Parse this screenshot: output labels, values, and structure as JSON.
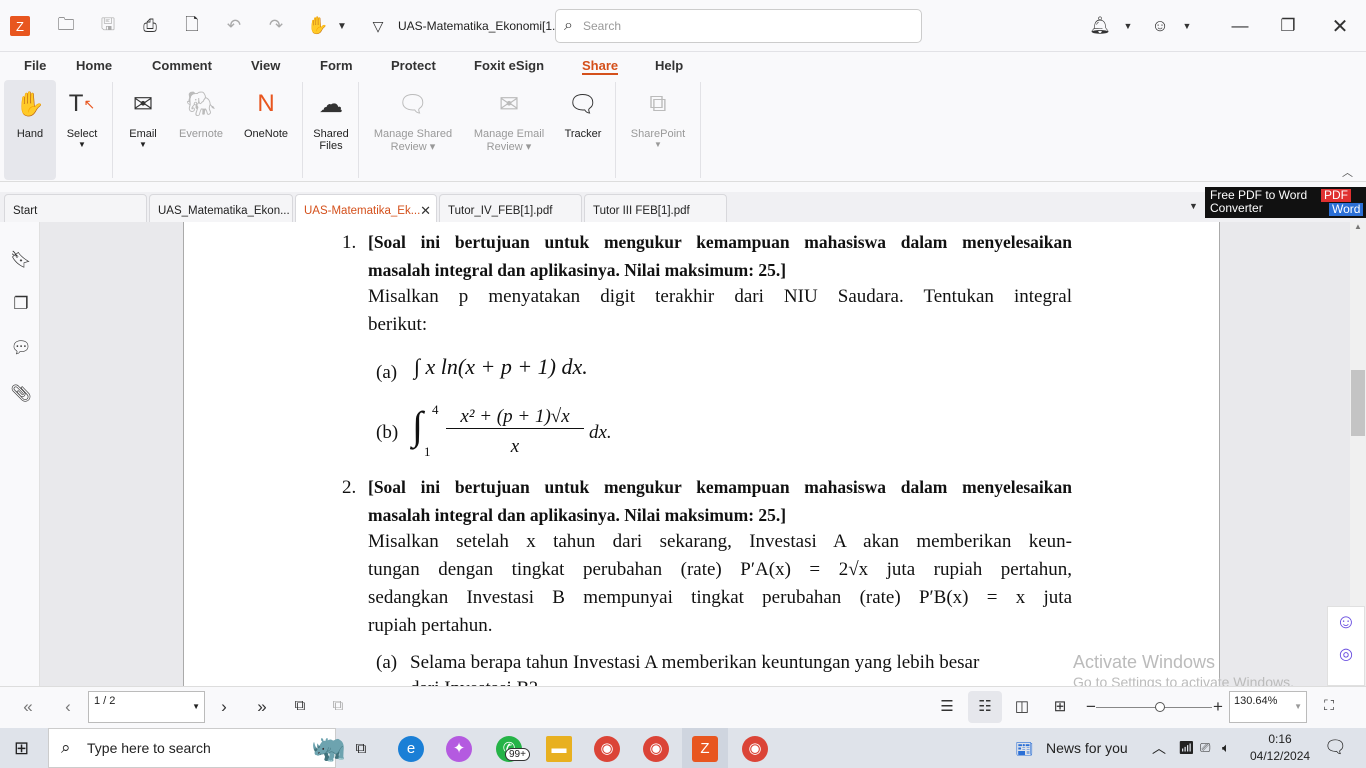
{
  "titlebar": {
    "doc_title": "UAS-Matematika_Ekonomi[1...",
    "search_placeholder": "Search"
  },
  "menu": [
    "File",
    "Home",
    "Comment",
    "View",
    "Form",
    "Protect",
    "Foxit eSign",
    "Share",
    "Help"
  ],
  "active_menu": "Share",
  "ribbon": {
    "hand": "Hand",
    "select": "Select",
    "email": "Email",
    "evernote": "Evernote",
    "onenote": "OneNote",
    "shared_files_1": "Shared",
    "shared_files_2": "Files",
    "manage_shared_1": "Manage Shared",
    "manage_shared_2": "Review ▾",
    "manage_email_1": "Manage Email",
    "manage_email_2": "Review ▾",
    "tracker": "Tracker",
    "sharepoint": "SharePoint"
  },
  "tabs": [
    "Start",
    "UAS_Matematika_Ekon...",
    "UAS-Matematika_Ek...",
    "Tutor_IV_FEB[1].pdf",
    "Tutor III FEB[1].pdf"
  ],
  "ad": {
    "line1": "Free PDF to Word",
    "line2": "Converter",
    "badge1": "PDF",
    "badge2": "Word"
  },
  "document": {
    "q1_num": "1.",
    "q1_l1": "[Soal ini bertujuan untuk mengukur kemampuan mahasiswa dalam menyelesaikan",
    "q1_l2": "masalah integral dan aplikasinya. Nilai maksimum: 25.]",
    "q1_l3": "Misalkan p menyatakan digit terakhir dari NIU Saudara. Tentukan integral",
    "q1_l4": "berikut:",
    "q1_a_label": "(a)",
    "q1_a": "∫ x ln(x + p + 1) dx.",
    "q1_b_label": "(b)",
    "q1_b_int": "∫",
    "q1_b_upper": "4",
    "q1_b_lower": "1",
    "q1_b_num": "x² + (p + 1)√x",
    "q1_b_den": "x",
    "q1_b_dx": "dx.",
    "q2_num": "2.",
    "q2_l1": "[Soal ini bertujuan untuk mengukur kemampuan mahasiswa dalam menyelesaikan",
    "q2_l2": "masalah integral dan aplikasinya. Nilai maksimum: 25.]",
    "q2_l3": "Misalkan setelah x tahun dari sekarang, Investasi A akan memberikan keun-",
    "q2_l4": "tungan dengan tingkat perubahan (rate) P′A(x) = 2√x juta rupiah pertahun,",
    "q2_l5": "sedangkan Investasi B mempunyai tingkat perubahan (rate) P′B(x) = x juta",
    "q2_l6": "rupiah pertahun.",
    "q2_a_label": "(a)",
    "q2_a": "Selama berapa tahun Investasi A memberikan keuntungan yang lebih besar",
    "q2_a2": "dari Investasi B?"
  },
  "watermark": {
    "line1": "Activate Windows",
    "line2": "Go to Settings to activate Windows."
  },
  "statusbar": {
    "page": "1 / 2",
    "zoom": "130.64%",
    "zoom_level": 0.55
  },
  "taskbar": {
    "search_placeholder": "Type here to search",
    "whatsapp_badge": "99+",
    "news": "News for you",
    "time": "0:16",
    "date": "04/12/2024"
  }
}
